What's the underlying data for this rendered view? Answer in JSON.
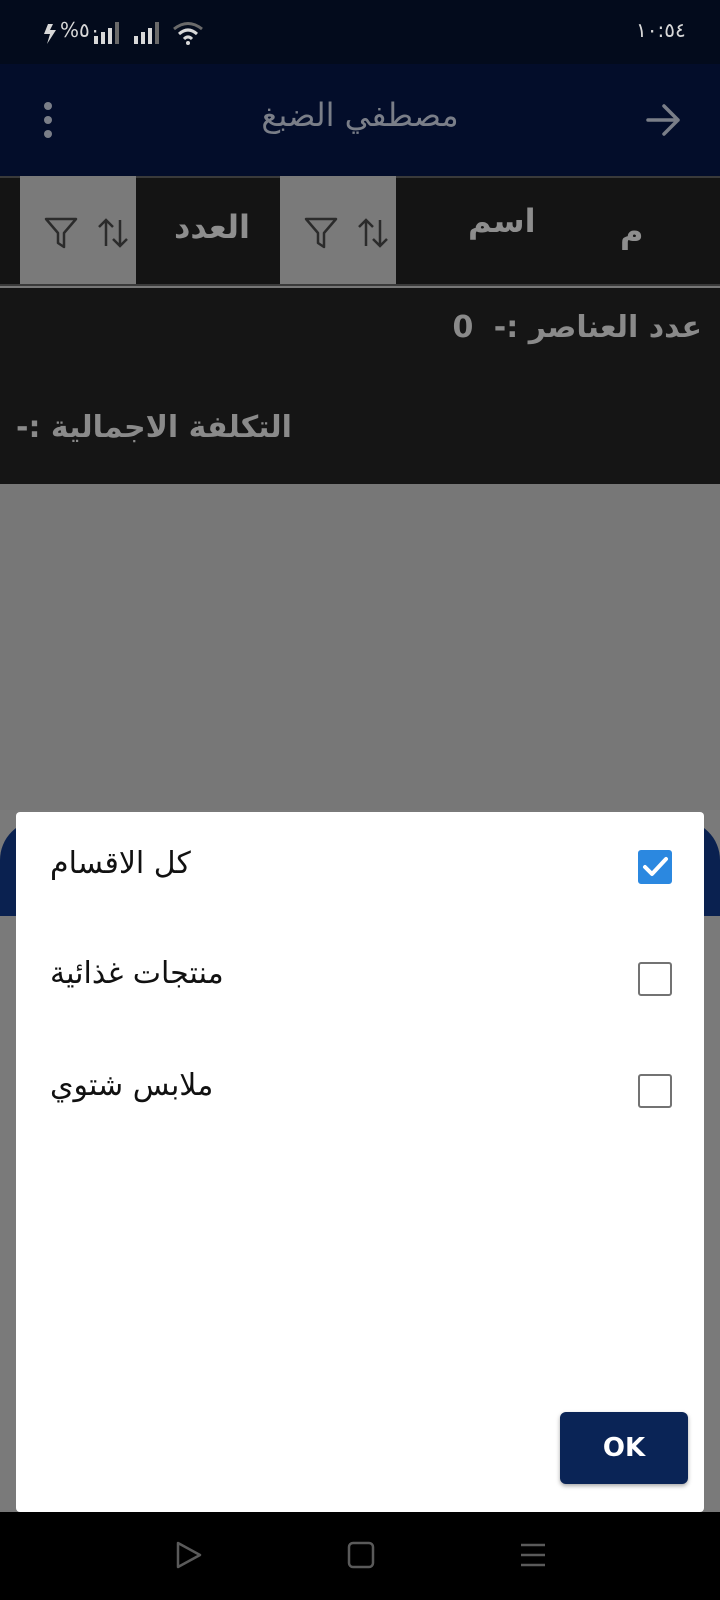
{
  "status_bar": {
    "time": "١٠:٥٤",
    "battery": "%٥٠"
  },
  "app_bar": {
    "title": "مصطفي الضبغ",
    "icons": {
      "back": "arrow-right-icon",
      "menu": "more-vert-icon"
    }
  },
  "table": {
    "columns": {
      "index": "م",
      "name": "اسم",
      "count": "العدد"
    },
    "icons": {
      "filter": "filter-icon",
      "sort": "sort-icon"
    }
  },
  "summary": {
    "items_count_label": "عدد العناصر :-",
    "items_count_value": "0",
    "total_cost_label": "التكلفة الاجمالية :-"
  },
  "dialog": {
    "options": [
      {
        "label": "كل الاقسام",
        "checked": true
      },
      {
        "label": "منتجات غذائية",
        "checked": false
      },
      {
        "label": "ملابس شتوي",
        "checked": false
      }
    ],
    "ok_label": "OK",
    "checkbox_color": "#2b88e0",
    "button_color": "#0a2456"
  },
  "nav_bar": {
    "icons": [
      "back-triangle-icon",
      "home-square-icon",
      "recents-menu-icon"
    ]
  }
}
